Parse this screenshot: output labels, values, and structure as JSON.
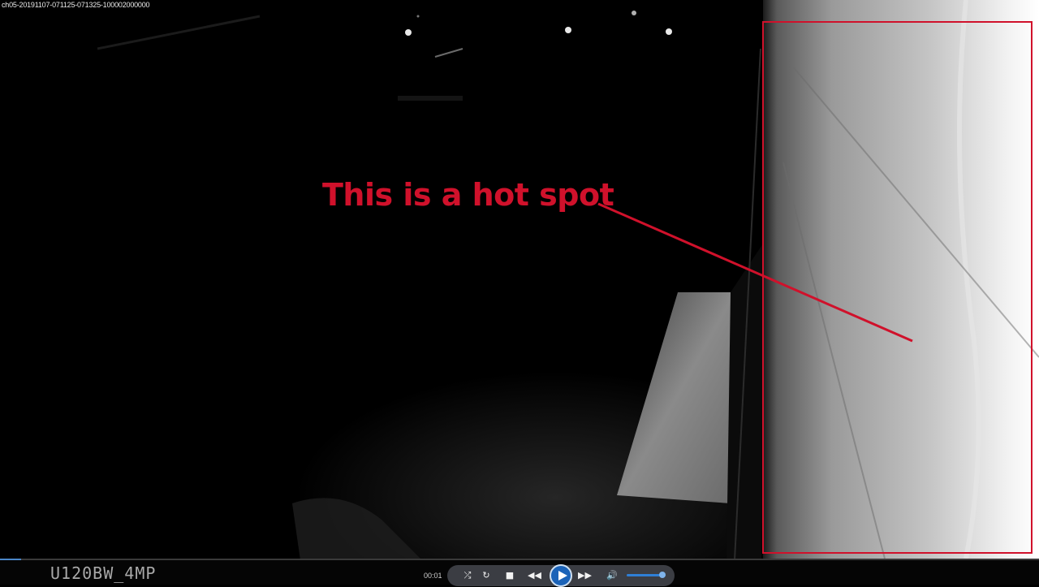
{
  "video": {
    "filename": "ch05-20191107-071125-071325-100002000000",
    "camera_model": "U120BW_4MP",
    "annotation_text": "This is a hot spot"
  },
  "player": {
    "time": "00:01",
    "progress_fraction": 0.02,
    "volume_fraction": 0.92,
    "icons": [
      "shuffle-icon",
      "loop-icon",
      "stop-icon",
      "rewind-icon",
      "play-icon",
      "fast-forward-icon",
      "volume-icon"
    ]
  },
  "colors": {
    "annotation": "#d0112b",
    "accent": "#1b63b8"
  }
}
